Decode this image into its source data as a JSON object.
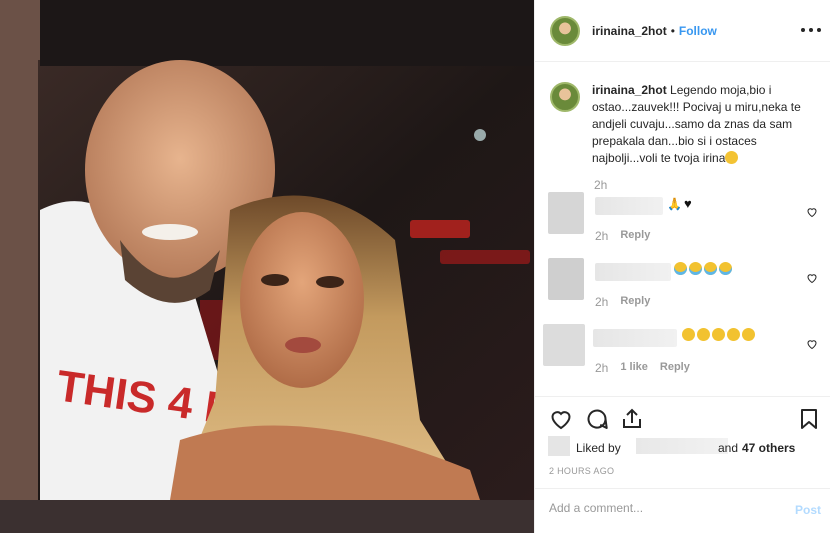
{
  "header": {
    "username": "irinaina_2hot",
    "separator": "•",
    "follow_label": "Follow"
  },
  "caption": {
    "username": "irinaina_2hot",
    "text": "Legendo moja,bio i ostao...zauvek!!! Pocivaj u miru,neka te andjeli cuvaju...samo da znas da sam prepakala dan...bio si i ostaces najbolji...voli te tvoja irina",
    "time": "2h"
  },
  "comments": [
    {
      "time": "2h",
      "reply_label": "Reply",
      "emojis": [
        "folded-hands",
        "black-heart"
      ]
    },
    {
      "time": "2h",
      "reply_label": "Reply",
      "emojis": [
        "crying-face",
        "crying-face",
        "crying-face",
        "crying-face"
      ]
    },
    {
      "time": "2h",
      "likes": "1 like",
      "reply_label": "Reply",
      "emojis": [
        "sad-face",
        "sad-face",
        "sad-face",
        "sad-face",
        "sad-face"
      ]
    }
  ],
  "likes": {
    "prefix": "Liked by",
    "and": "and",
    "others": "47 others"
  },
  "timestamp": "2 HOURS AGO",
  "add_comment": {
    "placeholder": "Add a comment...",
    "post_label": "Post"
  },
  "colors": {
    "link": "#3897f0",
    "muted": "#999999",
    "post_disabled": "#b3dbff"
  },
  "icons": [
    "heart-icon",
    "comment-icon",
    "share-icon",
    "bookmark-icon",
    "more-icon"
  ]
}
